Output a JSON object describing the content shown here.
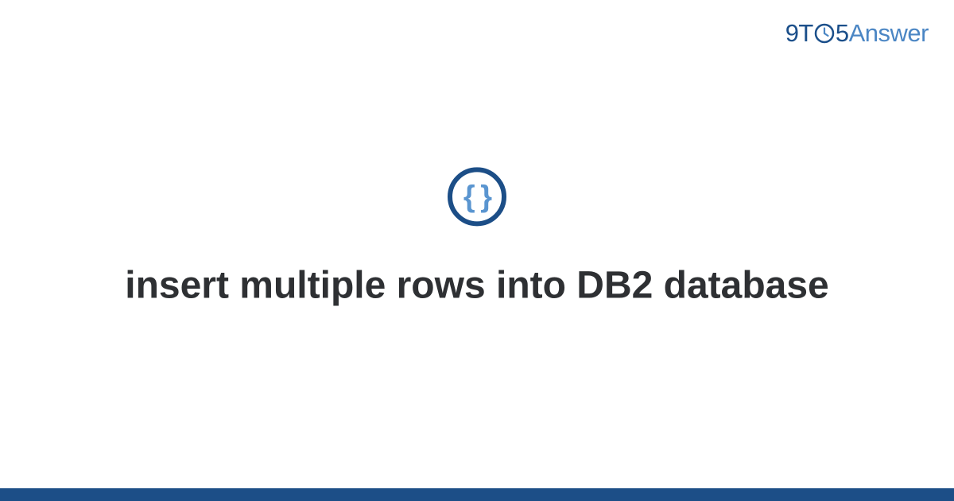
{
  "header": {
    "logo": {
      "prefix": "9T",
      "middle": "5",
      "suffix": "Answer"
    }
  },
  "main": {
    "icon": "code-braces-icon",
    "braces_text": "{ }",
    "title": "insert multiple rows into DB2 database"
  },
  "colors": {
    "primary_dark": "#1c4e87",
    "primary_light": "#4b86c4",
    "accent_blue": "#5a95d0",
    "text_dark": "#2e3033"
  }
}
